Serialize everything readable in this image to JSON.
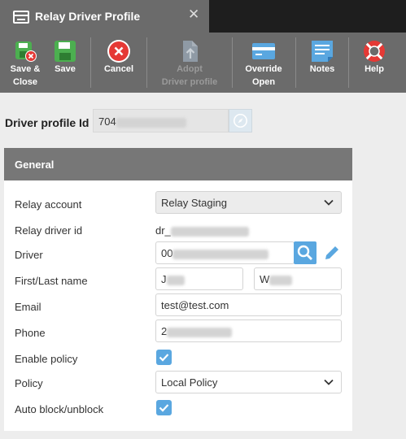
{
  "window": {
    "title": "Relay Driver Profile",
    "close_icon": "close-icon"
  },
  "toolbar": {
    "save_close": "Save &\nClose",
    "save": "Save",
    "cancel": "Cancel",
    "adopt": "Adopt\nDriver profile",
    "override": "Override\nOpen",
    "notes": "Notes",
    "help": "Help"
  },
  "profile": {
    "label": "Driver profile Id",
    "value_prefix": "704"
  },
  "general": {
    "title": "General",
    "relay_account": {
      "label": "Relay account",
      "value": "Relay Staging"
    },
    "relay_driver_id": {
      "label": "Relay driver id",
      "value_prefix": "dr_"
    },
    "driver": {
      "label": "Driver",
      "value_prefix": "00"
    },
    "name": {
      "label": "First/Last name",
      "first_prefix": "J",
      "last_prefix": "W"
    },
    "email": {
      "label": "Email",
      "value": "test@test.com"
    },
    "phone": {
      "label": "Phone",
      "value_prefix": "2"
    },
    "enable_policy": {
      "label": "Enable policy",
      "checked": true
    },
    "policy": {
      "label": "Policy",
      "value": "Local Policy"
    },
    "auto_block": {
      "label": "Auto block/unblock",
      "checked": true
    }
  },
  "colors": {
    "accent": "#5aa7e0",
    "toolbar": "#6b6b6b",
    "titlebar": "#1e1e1e",
    "panel_head": "#777777",
    "save_green": "#4caf50",
    "cancel_red": "#e53935"
  }
}
